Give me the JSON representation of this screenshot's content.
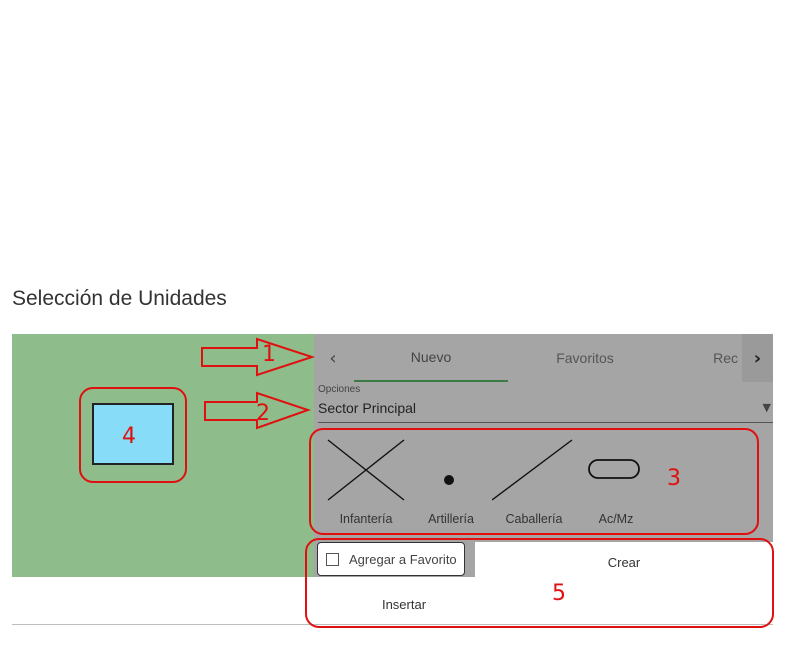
{
  "page": {
    "title": "Selección de Unidades"
  },
  "tabs": {
    "prev_icon": "‹",
    "next_icon": "›",
    "items": [
      {
        "label": "Nuevo",
        "active": true
      },
      {
        "label": "Favoritos",
        "active": false
      },
      {
        "label": "Rec",
        "active": false
      }
    ]
  },
  "options": {
    "label": "Opciones",
    "value": "Sector Principal",
    "arrow_icon": "▼"
  },
  "symbols": [
    {
      "label": "Infantería",
      "icon": "x-cross-icon"
    },
    {
      "label": "Artillería",
      "icon": "dot-icon"
    },
    {
      "label": "Caballería",
      "icon": "diagonal-line-icon"
    },
    {
      "label": "Ac/Mz",
      "icon": "oval-icon"
    }
  ],
  "actions": {
    "favorite_label": "Agregar a Favorito",
    "create_label": "Crear",
    "insert_label": "Insertar"
  },
  "annotations": {
    "a1": "1",
    "a2": "2",
    "a3": "3",
    "a4": "4",
    "a5": "5"
  },
  "colors": {
    "preview_bg": "#8fbc8b",
    "panel_bg": "#a5a5a5",
    "unit_fill": "#87dcf7",
    "active_tab": "#3c7a45",
    "annotation": "#e01010"
  }
}
